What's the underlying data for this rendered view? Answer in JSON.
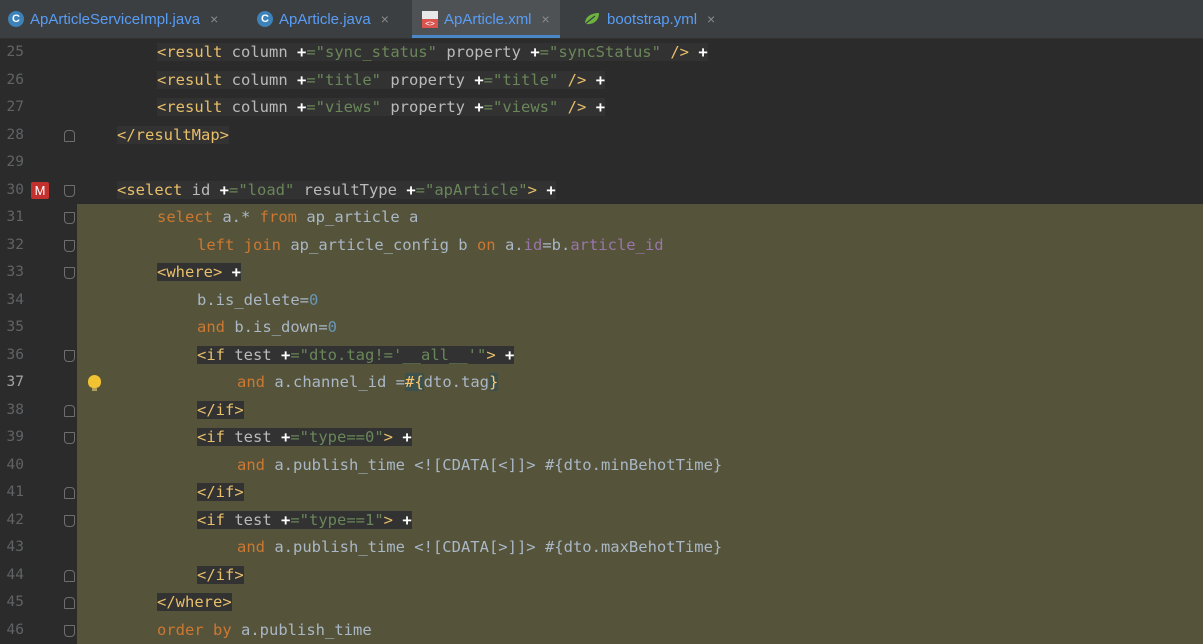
{
  "tabs": [
    {
      "label": "ApArticleServiceImpl.java",
      "icon": "java-class-icon",
      "close": "×"
    },
    {
      "label": "ApArticle.java",
      "icon": "java-class-icon",
      "close": "×"
    },
    {
      "label": "ApArticle.xml",
      "icon": "xml-file-icon",
      "close": "×",
      "active": true
    },
    {
      "label": "bootstrap.yml",
      "icon": "spring-leaf-icon",
      "close": "×"
    }
  ],
  "icons": {
    "java_class_letter": "C",
    "xml_badge": "<>"
  },
  "gutter": {
    "modified_marker": "M"
  },
  "lines": [
    {
      "n": "25",
      "segments": [
        [
          "tag",
          "<result "
        ],
        [
          "attr",
          "column "
        ],
        [
          "plus",
          "+"
        ],
        [
          "str",
          "=\"sync_status\" "
        ],
        [
          "attr",
          "property "
        ],
        [
          "plus",
          "+"
        ],
        [
          "str",
          "=\"syncStatus\" "
        ],
        [
          "tag",
          "/>"
        ],
        [
          "tx",
          " "
        ],
        [
          "plus",
          "+"
        ]
      ]
    },
    {
      "n": "26",
      "segments": [
        [
          "tag",
          "<result "
        ],
        [
          "attr",
          "column "
        ],
        [
          "plus",
          "+"
        ],
        [
          "str",
          "=\"title\" "
        ],
        [
          "attr",
          "property "
        ],
        [
          "plus",
          "+"
        ],
        [
          "str",
          "=\"title\" "
        ],
        [
          "tag",
          "/>"
        ],
        [
          "tx",
          " "
        ],
        [
          "plus",
          "+"
        ]
      ]
    },
    {
      "n": "27",
      "segments": [
        [
          "tag",
          "<result "
        ],
        [
          "attr",
          "column "
        ],
        [
          "plus",
          "+"
        ],
        [
          "str",
          "=\"views\" "
        ],
        [
          "attr",
          "property "
        ],
        [
          "plus",
          "+"
        ],
        [
          "str",
          "=\"views\" "
        ],
        [
          "tag",
          "/>"
        ],
        [
          "tx",
          " "
        ],
        [
          "plus",
          "+"
        ]
      ]
    },
    {
      "n": "28",
      "segments": [
        [
          "tag",
          "</resultMap>"
        ]
      ]
    },
    {
      "n": "29",
      "segments": []
    },
    {
      "n": "30",
      "segments": [
        [
          "tag",
          "<select "
        ],
        [
          "attr",
          "id "
        ],
        [
          "plus",
          "+"
        ],
        [
          "str",
          "=\"load\" "
        ],
        [
          "attr",
          "resultType "
        ],
        [
          "plus",
          "+"
        ],
        [
          "str",
          "=\"apArticle\""
        ],
        [
          "tag",
          ">"
        ],
        [
          "tx",
          " "
        ],
        [
          "plus",
          "+"
        ]
      ]
    },
    {
      "n": "31",
      "segments": [
        [
          "kw",
          "select "
        ],
        [
          "tx",
          "a.* "
        ],
        [
          "kw",
          "from "
        ],
        [
          "tx",
          "ap_article a"
        ]
      ]
    },
    {
      "n": "32",
      "segments": [
        [
          "kw",
          "left join "
        ],
        [
          "tx",
          "ap_article_config b "
        ],
        [
          "kw",
          "on "
        ],
        [
          "tx",
          "a."
        ],
        [
          "fld",
          "id"
        ],
        [
          "tx",
          "=b."
        ],
        [
          "fld",
          "article_id"
        ]
      ]
    },
    {
      "n": "33",
      "segments": [
        [
          "tag",
          "<where>"
        ],
        [
          "tx",
          " "
        ],
        [
          "plus",
          "+"
        ]
      ]
    },
    {
      "n": "34",
      "segments": [
        [
          "tx",
          "b.is_delete="
        ],
        [
          "num",
          "0"
        ]
      ]
    },
    {
      "n": "35",
      "segments": [
        [
          "kw",
          "and "
        ],
        [
          "tx",
          "b.is_down="
        ],
        [
          "num",
          "0"
        ]
      ]
    },
    {
      "n": "36",
      "segments": [
        [
          "tag",
          "<if "
        ],
        [
          "attr",
          "test "
        ],
        [
          "plus",
          "+"
        ],
        [
          "str",
          "=\"dto.tag!='__all__'\""
        ],
        [
          "tag",
          ">"
        ],
        [
          "tx",
          " "
        ],
        [
          "plus",
          "+"
        ]
      ]
    },
    {
      "n": "37",
      "segments": [
        [
          "kw",
          "and "
        ],
        [
          "tx",
          "a.channel_id ="
        ],
        [
          "param",
          "#{"
        ],
        [
          "tx",
          "dto.tag"
        ],
        [
          "param",
          "}"
        ]
      ]
    },
    {
      "n": "38",
      "segments": [
        [
          "tag",
          "</if>"
        ]
      ]
    },
    {
      "n": "39",
      "segments": [
        [
          "tag",
          "<if "
        ],
        [
          "attr",
          "test "
        ],
        [
          "plus",
          "+"
        ],
        [
          "str",
          "=\"type==0\""
        ],
        [
          "tag",
          ">"
        ],
        [
          "tx",
          " "
        ],
        [
          "plus",
          "+"
        ]
      ]
    },
    {
      "n": "40",
      "segments": [
        [
          "kw",
          "and "
        ],
        [
          "tx",
          "a.publish_time <![CDATA[<]]> #{dto.minBehotTime}"
        ]
      ]
    },
    {
      "n": "41",
      "segments": [
        [
          "tag",
          "</if>"
        ]
      ]
    },
    {
      "n": "42",
      "segments": [
        [
          "tag",
          "<if "
        ],
        [
          "attr",
          "test "
        ],
        [
          "plus",
          "+"
        ],
        [
          "str",
          "=\"type==1\""
        ],
        [
          "tag",
          ">"
        ],
        [
          "tx",
          " "
        ],
        [
          "plus",
          "+"
        ]
      ]
    },
    {
      "n": "43",
      "segments": [
        [
          "kw",
          "and "
        ],
        [
          "tx",
          "a.publish_time <![CDATA[>]]> #{dto.maxBehotTime}"
        ]
      ]
    },
    {
      "n": "44",
      "segments": [
        [
          "tag",
          "</if>"
        ]
      ]
    },
    {
      "n": "45",
      "segments": [
        [
          "tag",
          "</where>"
        ]
      ]
    },
    {
      "n": "46",
      "segments": [
        [
          "kw",
          "order by "
        ],
        [
          "tx",
          "a.publish_time"
        ]
      ]
    }
  ],
  "colors": {
    "background": "#2b2b2b",
    "tab_bar": "#3c3f41",
    "highlight": "#555339",
    "tag": "#e8bf6a",
    "string": "#6a8759",
    "keyword": "#cc7832",
    "number": "#6897bb",
    "field": "#9876aa"
  }
}
